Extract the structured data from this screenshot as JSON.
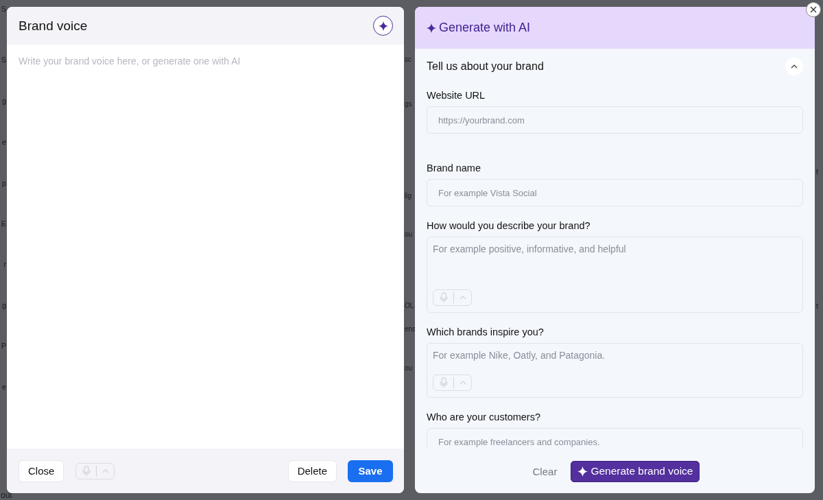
{
  "background_fragments": {
    "left": [
      "S",
      "S",
      "g",
      "e",
      "p",
      "E",
      "r",
      "g",
      "P",
      "e",
      "out"
    ],
    "middle": [
      "sc",
      "gs",
      "lig",
      "ou",
      "OL",
      "ens",
      "ou"
    ],
    "right": [
      "t",
      "t"
    ]
  },
  "brand_voice_panel": {
    "title": "Brand voice",
    "placeholder": "Write your brand voice here, or generate one with AI",
    "buttons": {
      "close": "Close",
      "delete": "Delete",
      "save": "Save"
    },
    "mic_disabled": true
  },
  "ai_panel": {
    "title": "Generate with AI",
    "section": {
      "title": "Tell us about your brand",
      "expanded": true
    },
    "fields": [
      {
        "kind": "input",
        "label": "Website URL",
        "placeholder": "https://yourbrand.com"
      },
      {
        "kind": "input",
        "label": "Brand name",
        "placeholder": "For example Vista Social"
      },
      {
        "kind": "textarea",
        "label": "How would you describe your brand?",
        "placeholder": "For example positive, informative, and helpful"
      },
      {
        "kind": "textarea",
        "label": "Which brands inspire you?",
        "placeholder": "For example Nike, Oatly, and Patagonia."
      },
      {
        "kind": "input",
        "label": "Who are your customers?",
        "placeholder": "For example freelancers and companies."
      }
    ],
    "buttons": {
      "clear": "Clear",
      "generate": "Generate brand voice"
    }
  }
}
